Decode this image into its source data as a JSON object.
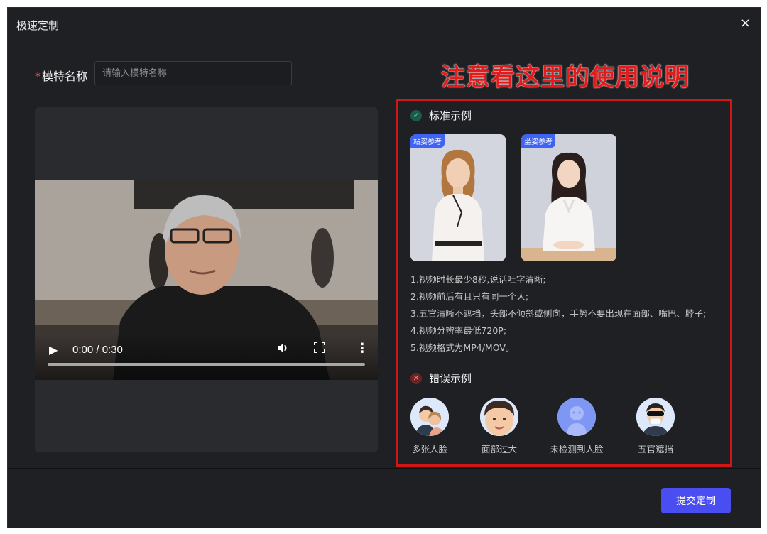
{
  "dialog": {
    "title": "极速定制",
    "close_glyph": "×"
  },
  "form": {
    "required_mark": "*",
    "model_name_label": "模特名称",
    "model_name_placeholder": "请输入模特名称",
    "model_name_value": ""
  },
  "annotation": {
    "text": "注意看这里的使用说明",
    "color": "#e11c1c"
  },
  "video": {
    "time": "0:00 / 0:30",
    "play_icon": "play-icon",
    "progress": 0.0
  },
  "standard": {
    "title": "标准示例",
    "cards": [
      {
        "tag": "站姿参考"
      },
      {
        "tag": "坐姿参考"
      }
    ],
    "rules": [
      "1.视频时长最少8秒,说话吐字清晰;",
      "2.视频前后有且只有同一个人;",
      "3.五官清晰不遮挡，头部不倾斜或侧向，手势不要出现在面部、嘴巴、脖子;",
      "4.视频分辨率最低720P;",
      "5.视频格式为MP4/MOV。"
    ]
  },
  "wrong": {
    "title": "错误示例",
    "items": [
      {
        "label": "多张人脸"
      },
      {
        "label": "面部过大"
      },
      {
        "label": "未检测到人脸"
      },
      {
        "label": "五官遮挡"
      }
    ]
  },
  "footer": {
    "submit_label": "提交定制",
    "accent": "#4a4ef0"
  }
}
